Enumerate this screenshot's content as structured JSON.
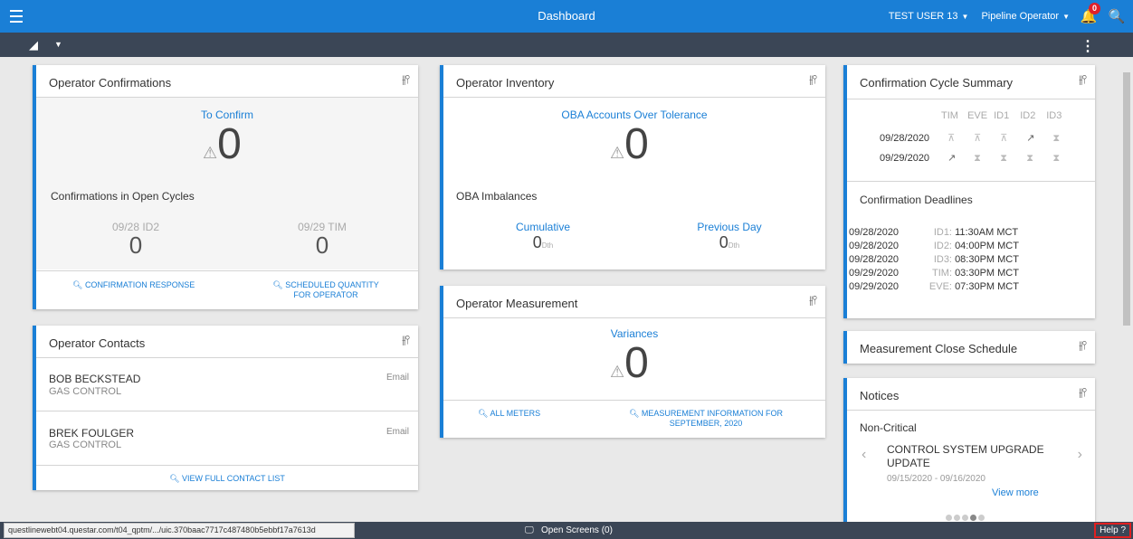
{
  "header": {
    "title": "Dashboard",
    "user": "TEST USER 13",
    "role": "Pipeline Operator",
    "notif_count": "0"
  },
  "operator_confirmations": {
    "title": "Operator Confirmations",
    "to_confirm_label": "To Confirm",
    "to_confirm_value": "0",
    "open_cycles_label": "Confirmations in Open Cycles",
    "cycle1_label": "09/28 ID2",
    "cycle1_value": "0",
    "cycle2_label": "09/29 TIM",
    "cycle2_value": "0",
    "link1": "CONFIRMATION RESPONSE",
    "link2_line1": "SCHEDULED QUANTITY",
    "link2_line2": "FOR OPERATOR"
  },
  "operator_contacts": {
    "title": "Operator Contacts",
    "contacts": [
      {
        "name": "BOB BECKSTEAD",
        "dept": "GAS CONTROL",
        "action": "Email"
      },
      {
        "name": "BREK FOULGER",
        "dept": "GAS CONTROL",
        "action": "Email"
      }
    ],
    "link": "VIEW FULL CONTACT LIST"
  },
  "operator_inventory": {
    "title": "Operator Inventory",
    "oba_label": "OBA Accounts Over Tolerance",
    "oba_value": "0",
    "imbalances_label": "OBA Imbalances",
    "cumulative_label": "Cumulative",
    "cumulative_value": "0",
    "previous_label": "Previous Day",
    "previous_value": "0",
    "unit": "Dth"
  },
  "operator_measurement": {
    "title": "Operator Measurement",
    "variances_label": "Variances",
    "variances_value": "0",
    "link1": "ALL METERS",
    "link2_line1": "MEASUREMENT INFORMATION FOR",
    "link2_line2": "SEPTEMBER, 2020"
  },
  "cycle_summary": {
    "title": "Confirmation Cycle Summary",
    "headers": [
      "TIM",
      "EVE",
      "ID1",
      "ID2",
      "ID3"
    ],
    "rows": [
      {
        "date": "09/28/2020",
        "cells": [
          "⊼",
          "⊼",
          "⊼",
          "↗",
          "⧗"
        ]
      },
      {
        "date": "09/29/2020",
        "cells": [
          "↗",
          "⧗",
          "⧗",
          "⧗",
          "⧗"
        ]
      }
    ]
  },
  "deadlines": {
    "title": "Confirmation Deadlines",
    "rows": [
      {
        "date": "09/28/2020",
        "cycle": "ID1:",
        "time": "11:30AM MCT"
      },
      {
        "date": "09/28/2020",
        "cycle": "ID2:",
        "time": "04:00PM MCT"
      },
      {
        "date": "09/28/2020",
        "cycle": "ID3:",
        "time": "08:30PM MCT"
      },
      {
        "date": "09/29/2020",
        "cycle": "TIM:",
        "time": "03:30PM MCT"
      },
      {
        "date": "09/29/2020",
        "cycle": "EVE:",
        "time": "07:30PM MCT"
      }
    ]
  },
  "measurement_close": {
    "title": "Measurement Close Schedule"
  },
  "notices": {
    "title": "Notices",
    "category": "Non-Critical",
    "headline_line1": "CONTROL SYSTEM UPGRADE",
    "headline_line2": "UPDATE",
    "date_range": "09/15/2020 - 09/16/2020",
    "view_more": "View more"
  },
  "status_bar": {
    "url": "questlinewebt04.questar.com/t04_qptm/.../uic.370baac7717c487480b5ebbf17a7613d",
    "open_screens": "Open Screens (0)",
    "help": "Help ?"
  }
}
